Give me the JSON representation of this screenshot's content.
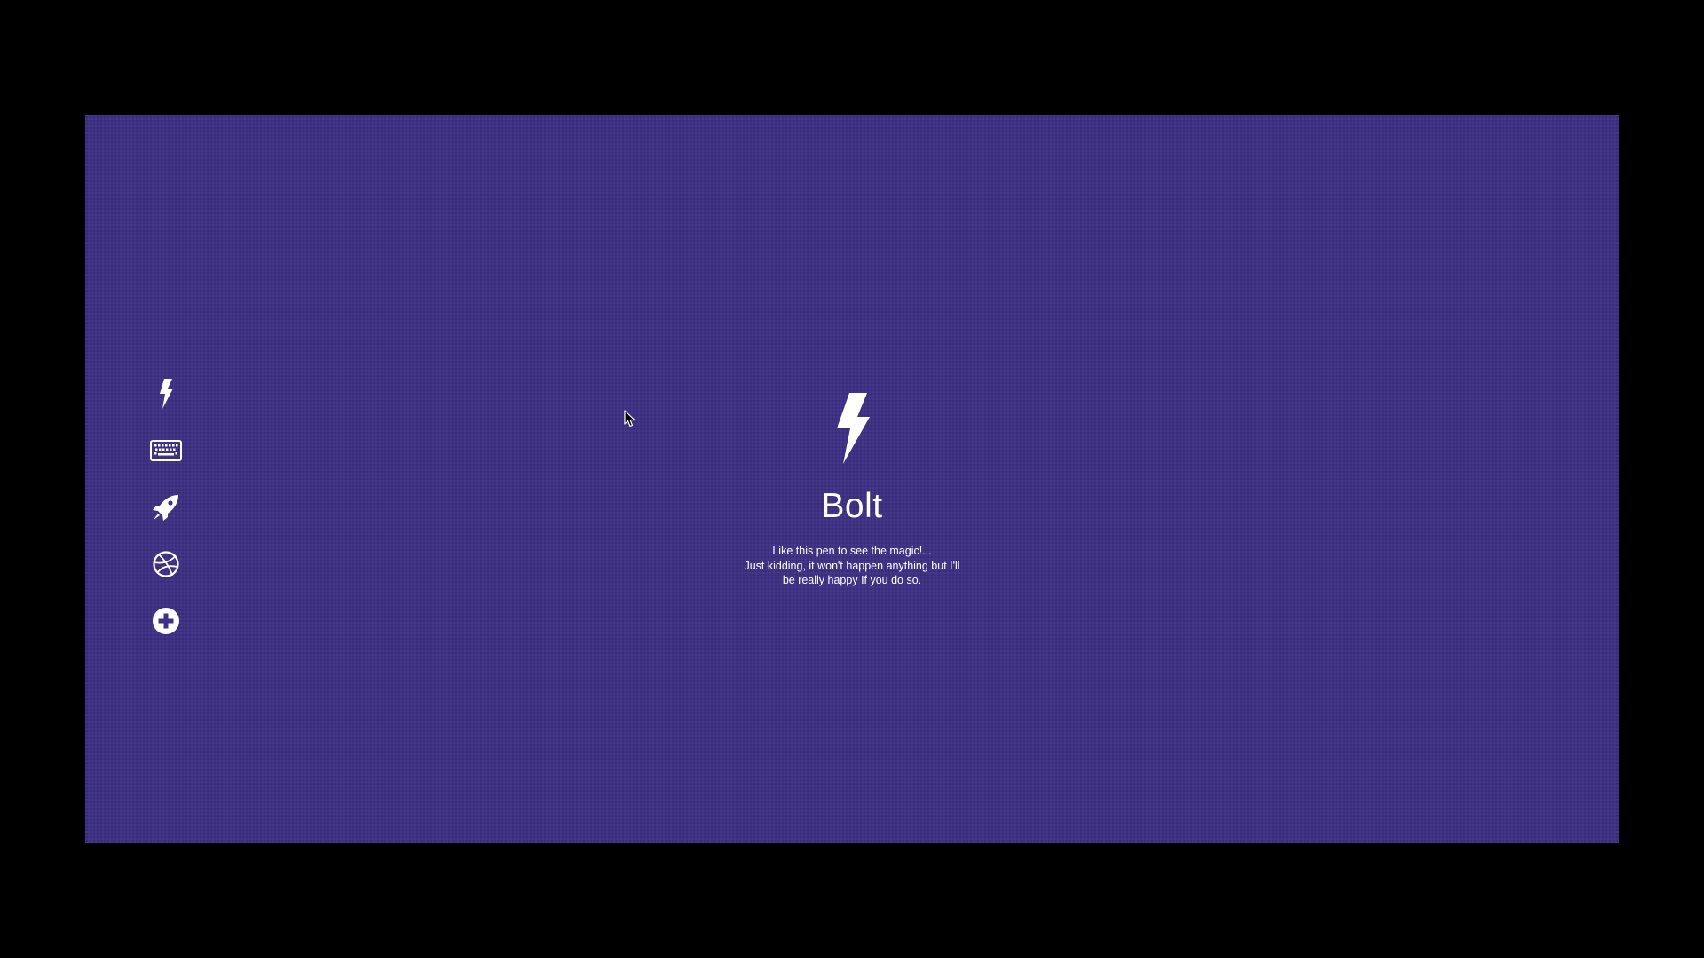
{
  "sidebar": {
    "items": [
      {
        "icon": "bolt-icon",
        "label": "Bolt"
      },
      {
        "icon": "keyboard-icon",
        "label": "Keyboard"
      },
      {
        "icon": "rocket-icon",
        "label": "Rocket"
      },
      {
        "icon": "dribbble-icon",
        "label": "Dribbble"
      },
      {
        "icon": "plus-circle-icon",
        "label": "Add"
      }
    ]
  },
  "hero": {
    "icon": "bolt-icon",
    "title": "Bolt",
    "text_lines": [
      "Like this pen to see the magic!...",
      "Just kidding, it won't happen anything but I'll",
      "be really happy If you do so."
    ]
  },
  "colors": {
    "background": "#3f3183",
    "outer_frame": "#000000",
    "foreground": "#ffffff"
  }
}
